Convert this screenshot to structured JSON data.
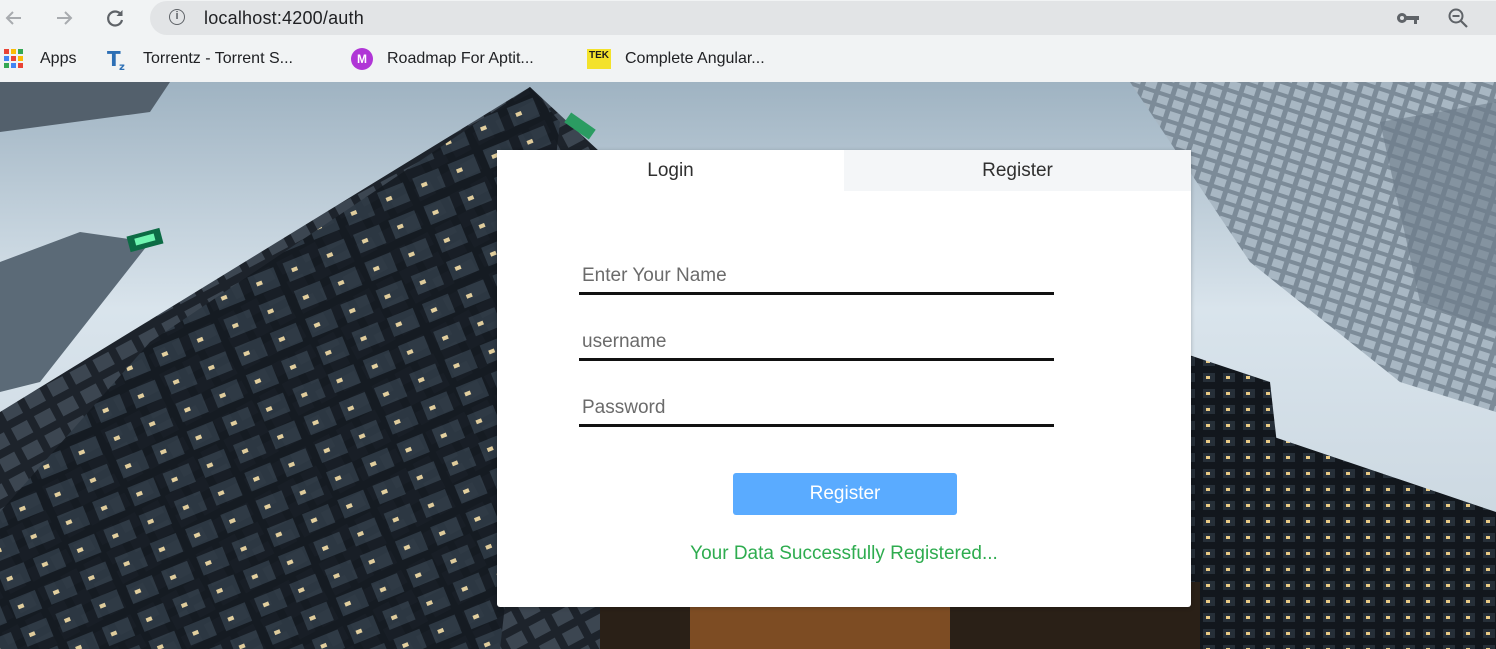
{
  "browser": {
    "url": "localhost:4200/auth",
    "bookmarks": [
      {
        "label": "Apps",
        "icon": "apps-grid-icon"
      },
      {
        "label": "Torrentz - Torrent S...",
        "icon": "torrentz-icon",
        "icon_text": "T",
        "icon_sub": "z"
      },
      {
        "label": "Roadmap For Aptit...",
        "icon": "m-circle-icon",
        "icon_text": "M"
      },
      {
        "label": "Complete Angular...",
        "icon": "tek-icon",
        "icon_text": "TEK"
      }
    ]
  },
  "auth": {
    "tabs": [
      {
        "label": "Login",
        "active": true
      },
      {
        "label": "Register",
        "active": false
      }
    ],
    "fields": {
      "name_placeholder": "Enter Your Name",
      "username_placeholder": "username",
      "password_placeholder": "Password"
    },
    "submit_label": "Register",
    "status_message": "Your Data Successfully Registered..."
  },
  "colors": {
    "button": "#5aabff",
    "success": "#2eac4f",
    "chrome": "#f1f3f4"
  }
}
